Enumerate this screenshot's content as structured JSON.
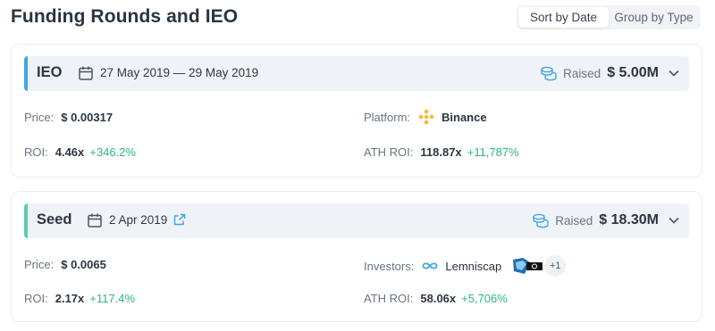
{
  "page": {
    "title": "Funding Rounds and IEO"
  },
  "sort": {
    "by_date": "Sort by Date",
    "by_type": "Group by Type",
    "selected": "Sort by Date"
  },
  "rounds": [
    {
      "name": "IEO",
      "accent": "#3fa7e0",
      "date": "27 May 2019 — 29 May 2019",
      "raised_label": "Raised",
      "raised": "$ 5.00M",
      "price_label": "Price:",
      "price": "$ 0.00317",
      "roi_label": "ROI:",
      "roi": "4.46x",
      "roi_pct": "+346.2%",
      "platform_label": "Platform:",
      "platform": "Binance",
      "platform_icon": "binance-icon",
      "ath_label": "ATH ROI:",
      "ath_roi": "118.87x",
      "ath_pct": "+11,787%"
    },
    {
      "name": "Seed",
      "accent": "#5ccda8",
      "date": "2 Apr 2019",
      "raised_label": "Raised",
      "raised": "$ 18.30M",
      "price_label": "Price:",
      "price": "$ 0.0065",
      "roi_label": "ROI:",
      "roi": "2.17x",
      "roi_pct": "+117.4%",
      "investors_label": "Investors:",
      "investor": "Lemniscap",
      "investor_icon": "lemniscap-icon",
      "investors_more": "+1",
      "ath_label": "ATH ROI:",
      "ath_roi": "58.06x",
      "ath_pct": "+5,706%"
    }
  ],
  "colors": {
    "positive": "#2cb67d",
    "header_bg": "#eff3f7",
    "binance": "#f3ba2f",
    "link": "#3fa7e0"
  }
}
